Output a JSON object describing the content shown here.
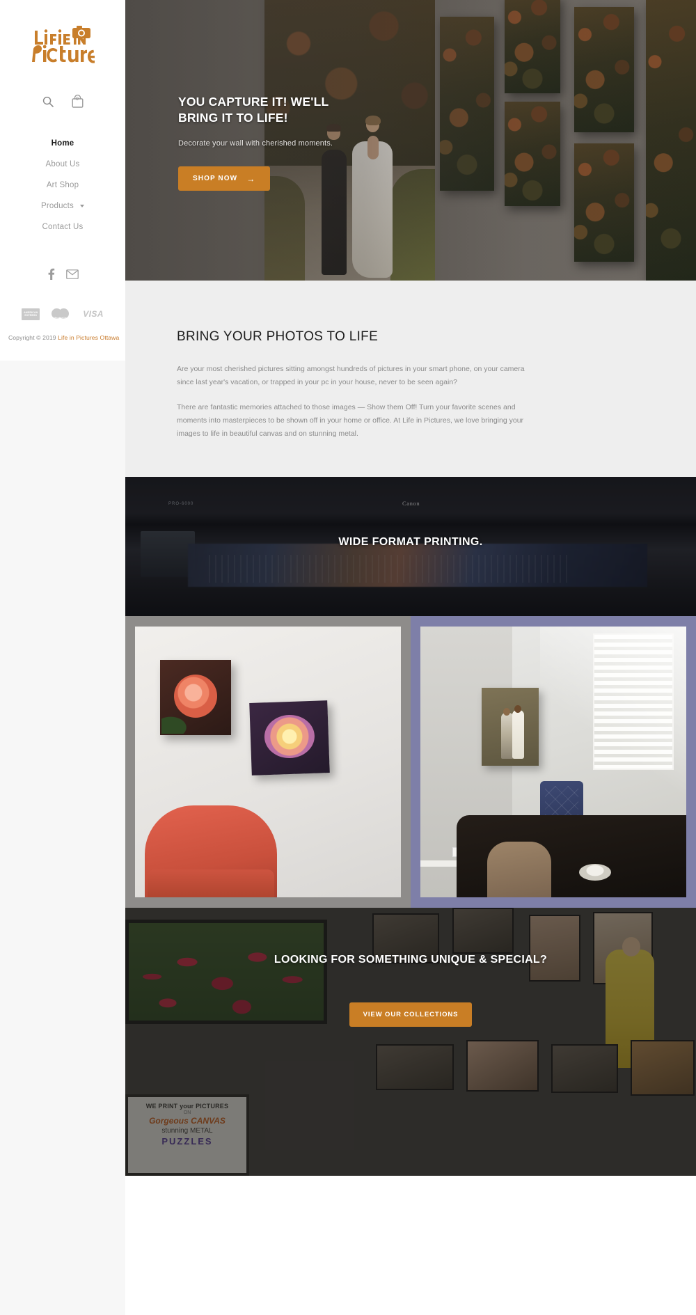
{
  "sidebar": {
    "logo": {
      "line1": "Life in",
      "line2": "Pictures",
      "icon": "camera-icon",
      "color": "#c87e2b"
    },
    "search_icon": "search-icon",
    "cart_icon": "shopping-bag-icon",
    "cart_count": "0",
    "nav": [
      {
        "label": "Home",
        "active": true,
        "has_dropdown": false
      },
      {
        "label": "About Us",
        "active": false,
        "has_dropdown": false
      },
      {
        "label": "Art Shop",
        "active": false,
        "has_dropdown": false
      },
      {
        "label": "Products",
        "active": false,
        "has_dropdown": true
      },
      {
        "label": "Contact Us",
        "active": false,
        "has_dropdown": false
      }
    ],
    "social": [
      {
        "name": "facebook-icon",
        "glyph": "f"
      },
      {
        "name": "email-icon",
        "glyph": "envelope"
      }
    ],
    "payments": [
      {
        "name": "amex-icon",
        "label_line1": "AMERICAN",
        "label_line2": "EXPRESS"
      },
      {
        "name": "mastercard-icon",
        "label": "MasterCard"
      },
      {
        "name": "visa-icon",
        "label": "VISA"
      }
    ],
    "copyright_prefix": "Copyright © 2019 ",
    "copyright_link": "Life in Pictures Ottawa"
  },
  "hero": {
    "title": "YOU CAPTURE IT!  WE'LL\nBRING IT TO LIFE!",
    "subtitle": "Decorate your wall with cherished moments.",
    "cta_label": "SHOP NOW",
    "cta_arrow": "→",
    "cta_color": "#c97e25"
  },
  "intro": {
    "heading": "BRING YOUR PHOTOS TO LIFE",
    "paragraph1": "Are your most cherished pictures sitting amongst hundreds of pictures in your smart phone, on your camera since last year's vacation, or trapped in your pc in your house, never to be seen again?",
    "paragraph2": "There are fantastic memories attached to those images — Show them Off! Turn your favorite scenes and moments into masterpieces to be shown off in your home or office. At Life in Pictures, we love bringing your images to life in beautiful canvas and on stunning metal."
  },
  "wide_format": {
    "title": "WIDE FORMAT PRINTING.",
    "printer_model": "PRO-6000",
    "printer_brand": "Canon"
  },
  "bottom_band": {
    "title": "LOOKING FOR SOMETHING UNIQUE & SPECIAL?",
    "cta_label": "VIEW OUR COLLECTIONS",
    "cta_color": "#c97e25",
    "poster": {
      "line1": "WE PRINT your PICTURES",
      "line2": "ON",
      "line3": "Gorgeous CANVAS",
      "line4": "stunning METAL",
      "line5": "PUZZLES"
    }
  }
}
